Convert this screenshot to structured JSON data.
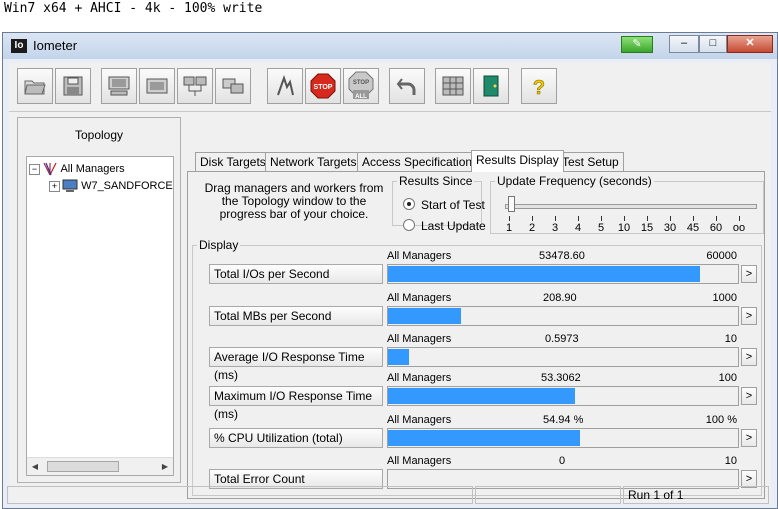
{
  "caption": "Win7 x64 + AHCI - 4k - 100% write",
  "window": {
    "title": "Iometer",
    "icon_text": "Io",
    "minimize": "–",
    "maximize": "□",
    "close": "✕"
  },
  "toolbar": [
    {
      "name": "open-config-button",
      "icon": "folder-icon"
    },
    {
      "name": "save-config-button",
      "icon": "floppy-icon"
    },
    {
      "name": "start-disk-worker-button",
      "icon": "disk-worker-icon"
    },
    {
      "name": "start-network-worker-button",
      "icon": "network-worker-icon"
    },
    {
      "name": "duplicate-worker-button",
      "icon": "duplicate-icon"
    },
    {
      "name": "disconnect-button",
      "icon": "disconnect-icon"
    },
    {
      "name": "start-tests-button",
      "icon": "start-flag-icon"
    },
    {
      "name": "stop-button",
      "icon": "stop-icon",
      "label": "STOP"
    },
    {
      "name": "stop-all-button",
      "icon": "stop-all-icon",
      "label": "STOP ALL"
    },
    {
      "name": "reset-workers-button",
      "icon": "undo-arrow-icon"
    },
    {
      "name": "fiber-button",
      "icon": "grid-icon"
    },
    {
      "name": "exit-button",
      "icon": "exit-door-icon"
    },
    {
      "name": "about-button",
      "icon": "question-icon",
      "label": "?"
    }
  ],
  "topology": {
    "heading": "Topology",
    "items": [
      {
        "label": "All Managers",
        "expander": "−"
      },
      {
        "label": "W7_SANDFORCE",
        "expander": "+"
      }
    ]
  },
  "tabs": [
    {
      "label": "Disk Targets",
      "active": false
    },
    {
      "label": "Network Targets",
      "active": false
    },
    {
      "label": "Access Specifications",
      "active": false
    },
    {
      "label": "Results Display",
      "active": true
    },
    {
      "label": "Test Setup",
      "active": false
    }
  ],
  "drag_hint": "Drag managers and workers from the Topology window to the progress bar of your choice.",
  "results_since": {
    "legend": "Results Since",
    "options": [
      {
        "label": "Start of Test",
        "selected": true
      },
      {
        "label": "Last Update",
        "selected": false
      }
    ]
  },
  "update_frequency": {
    "legend": "Update Frequency (seconds)",
    "ticks": [
      "1",
      "2",
      "3",
      "4",
      "5",
      "10",
      "15",
      "30",
      "45",
      "60",
      "oo"
    ],
    "selected": "1"
  },
  "display": {
    "legend": "Display",
    "metrics": [
      {
        "label": "Total I/Os per Second",
        "source": "All Managers",
        "value": "53478.60",
        "max": "60000",
        "fraction": 0.8913
      },
      {
        "label": "Total MBs per Second",
        "source": "All Managers",
        "value": "208.90",
        "max": "1000",
        "fraction": 0.2089
      },
      {
        "label": "Average I/O Response Time (ms)",
        "source": "All Managers",
        "value": "0.5973",
        "max": "10",
        "fraction": 0.0597
      },
      {
        "label": "Maximum I/O Response Time (ms)",
        "source": "All Managers",
        "value": "53.3062",
        "max": "100",
        "fraction": 0.533
      },
      {
        "label": "% CPU Utilization (total)",
        "source": "All Managers",
        "value": "54.94 %",
        "max": "100 %",
        "fraction": 0.5494
      },
      {
        "label": "Total Error Count",
        "source": "All Managers",
        "value": "0",
        "max": "10",
        "fraction": 0
      }
    ],
    "more_label": ">"
  },
  "status": {
    "cells": [
      "",
      "",
      "",
      "Run 1 of 1"
    ]
  },
  "colors": {
    "bar": "#3399ff",
    "close_button": "#c74a32"
  }
}
